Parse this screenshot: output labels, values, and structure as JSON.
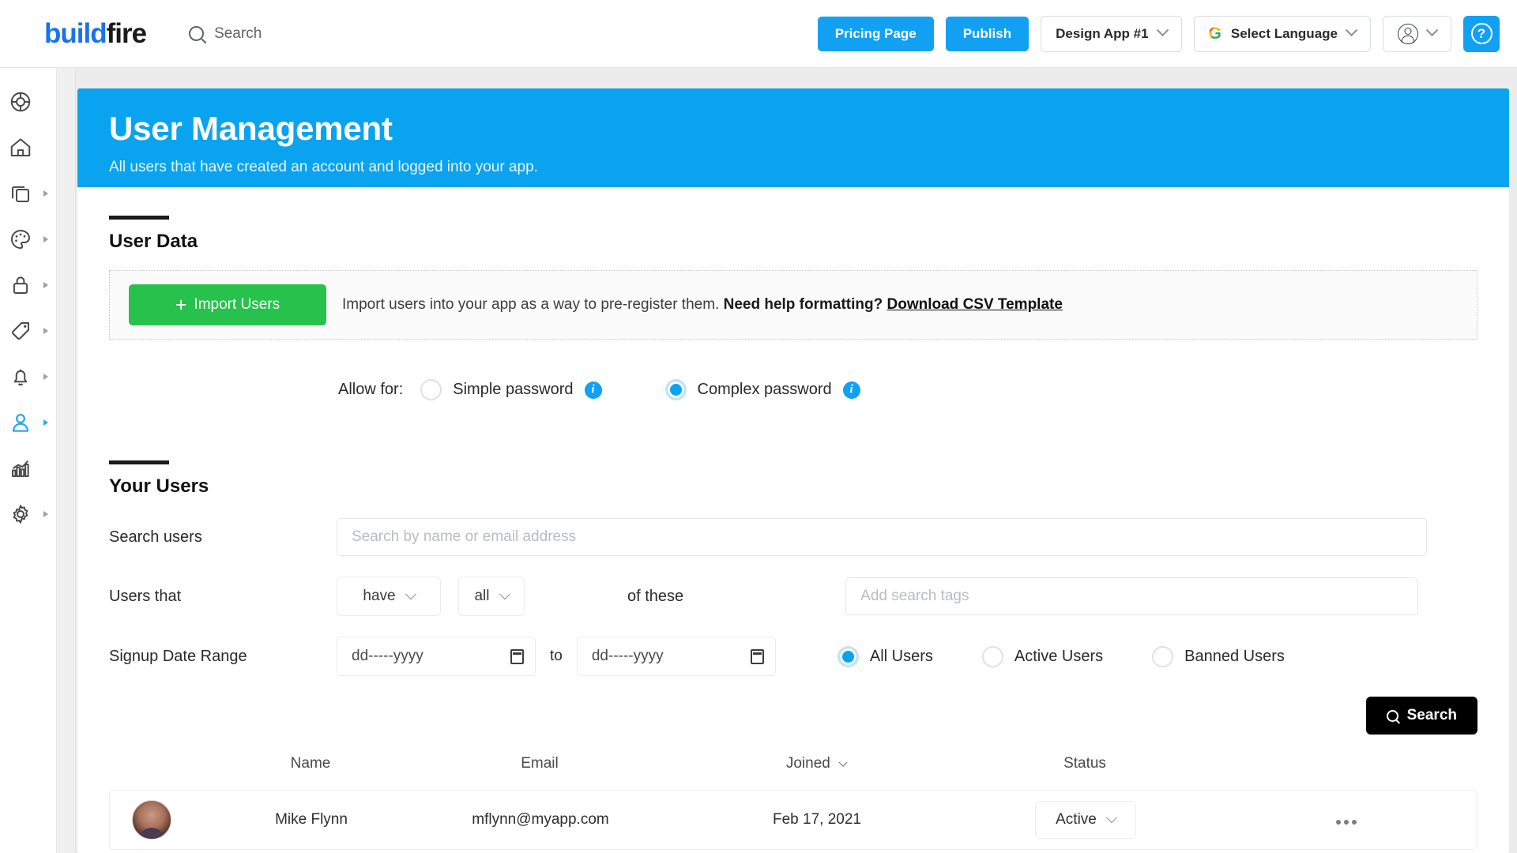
{
  "topbar": {
    "logo_build": "build",
    "logo_fire": "fire",
    "search_label": "Search",
    "pricing_page": "Pricing Page",
    "publish": "Publish",
    "app_selector": "Design App #1",
    "language_selector": "Select Language",
    "google_letter": "G",
    "help_symbol": "?"
  },
  "sidebar": {
    "items": [
      {
        "name": "lifebuoy-icon",
        "label": "Support",
        "has_arrow": false,
        "active": false
      },
      {
        "name": "home-icon",
        "label": "Home",
        "has_arrow": false,
        "active": false
      },
      {
        "name": "pages-icon",
        "label": "Pages",
        "has_arrow": true,
        "active": false
      },
      {
        "name": "palette-icon",
        "label": "Appearance",
        "has_arrow": true,
        "active": false
      },
      {
        "name": "lock-icon",
        "label": "Security",
        "has_arrow": true,
        "active": false
      },
      {
        "name": "tag-icon",
        "label": "Tags",
        "has_arrow": true,
        "active": false
      },
      {
        "name": "bell-icon",
        "label": "Notifications",
        "has_arrow": true,
        "active": false
      },
      {
        "name": "user-icon",
        "label": "Users",
        "has_arrow": true,
        "active": true
      },
      {
        "name": "analytics-icon",
        "label": "Analytics",
        "has_arrow": false,
        "active": false
      },
      {
        "name": "gear-icon",
        "label": "Settings",
        "has_arrow": true,
        "active": false
      }
    ]
  },
  "banner": {
    "title": "User Management",
    "subtitle": "All users that have created an account and logged into your app."
  },
  "user_data": {
    "section_title": "User Data",
    "import_button": "Import Users",
    "import_plus": "+",
    "import_desc_1": "Import users into your app as a way to pre-register them.",
    "import_desc_bold": "Need help formatting?",
    "import_link": "Download CSV Template",
    "allow_label": "Allow for:",
    "options": [
      {
        "label": "Simple password",
        "selected": false,
        "info": "i"
      },
      {
        "label": "Complex password",
        "selected": true,
        "info": "i"
      }
    ]
  },
  "your_users": {
    "section_title": "Your Users",
    "search_label": "Search users",
    "search_placeholder": "Search by name or email address",
    "users_that_label": "Users that",
    "have_select": "have",
    "all_select": "all",
    "of_these_label": "of these",
    "tags_placeholder": "Add search tags",
    "date_range_label": "Signup Date Range",
    "date_from_placeholder": "dd-----yyyy",
    "date_to_placeholder": "dd-----yyyy",
    "to_label": "to",
    "status_filters": [
      {
        "label": "All Users",
        "selected": true
      },
      {
        "label": "Active Users",
        "selected": false
      },
      {
        "label": "Banned Users",
        "selected": false
      }
    ],
    "search_button": "Search"
  },
  "table": {
    "columns": {
      "name": "Name",
      "email": "Email",
      "joined": "Joined",
      "status": "Status"
    },
    "rows": [
      {
        "name": "Mike Flynn",
        "email": "mflynn@myapp.com",
        "joined": "Feb 17, 2021",
        "status": "Active"
      }
    ]
  },
  "colors": {
    "brand_blue": "#0aa3ef",
    "accent_blue": "#12a1f2",
    "import_green": "#27c24c",
    "logo_blue": "#1a73e8",
    "search_black": "#000000"
  }
}
